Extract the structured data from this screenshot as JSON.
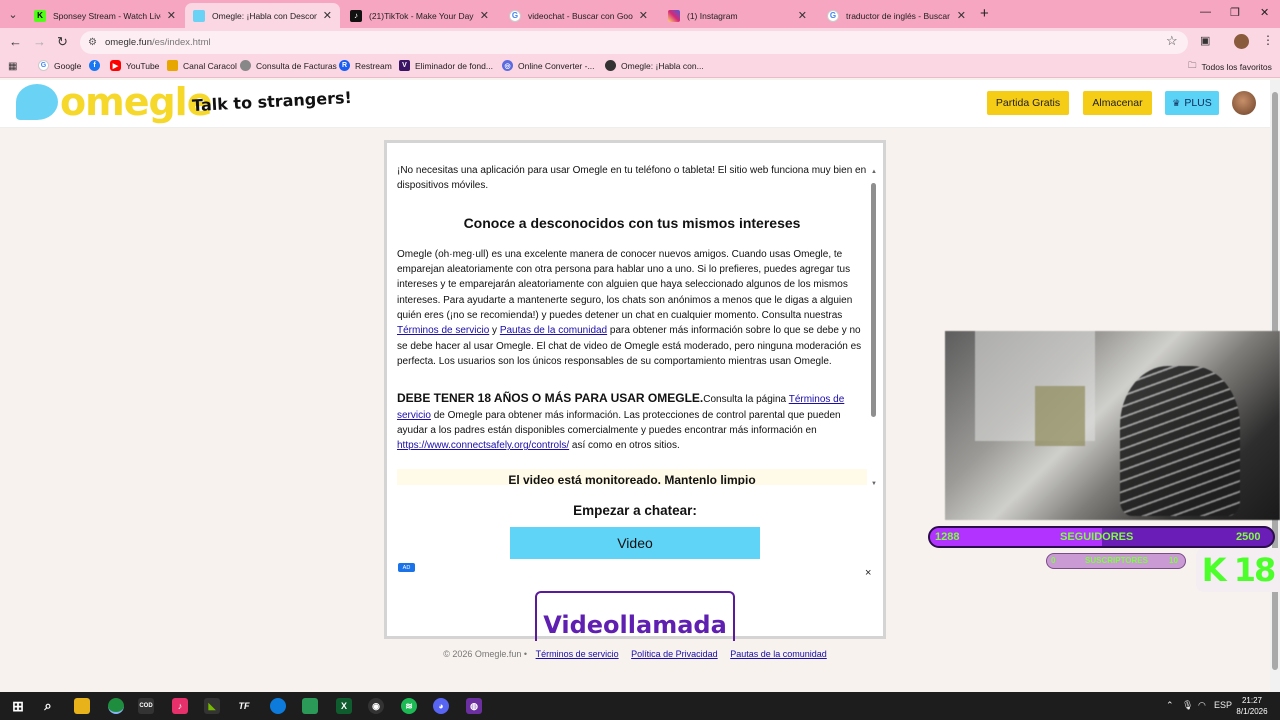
{
  "browser": {
    "tabs": [
      {
        "title": "Sponsey Stream - Watch Live o",
        "icon": "kick-icon",
        "color": "#53fc18",
        "active": false
      },
      {
        "title": "Omegle: ¡Habla con Desconoci",
        "icon": "omegle-icon",
        "color": "#6ad3f5",
        "active": true
      },
      {
        "title": "(21)TikTok - Make Your Day",
        "icon": "tiktok-icon",
        "color": "#111111",
        "active": false
      },
      {
        "title": "videochat - Buscar con Google",
        "icon": "google-icon",
        "color": "#4285f4",
        "active": false
      },
      {
        "title": "(1) Instagram",
        "icon": "instagram-icon",
        "color": "#d6249f",
        "active": false
      },
      {
        "title": "traductor de inglés - Buscar co",
        "icon": "google-icon",
        "color": "#4285f4",
        "active": false
      }
    ],
    "url_host": "omegle.fun",
    "url_path": "/es/index.html",
    "bookmarks": [
      {
        "label": "Google",
        "icon": "google-icon",
        "color": "#4285f4"
      },
      {
        "label": "",
        "icon": "facebook-icon",
        "color": "#1877f2"
      },
      {
        "label": "YouTube",
        "icon": "youtube-icon",
        "color": "#ff0000"
      },
      {
        "label": "Canal Caracol",
        "icon": "caracol-icon",
        "color": "#e8a600"
      },
      {
        "label": "Consulta de Facturas",
        "icon": "dian-icon",
        "color": "#888888"
      },
      {
        "label": "Restream",
        "icon": "restream-icon",
        "color": "#1a5ef3"
      },
      {
        "label": "Eliminador de fond...",
        "icon": "removebg-icon",
        "color": "#3b1466"
      },
      {
        "label": "Online Converter -...",
        "icon": "converter-icon",
        "color": "#5a6be0"
      },
      {
        "label": "Omegle: ¡Habla con...",
        "icon": "omegle-icon",
        "color": "#333333"
      }
    ],
    "all_bookmarks": "Todos los favoritos"
  },
  "header": {
    "logo": "omegle",
    "tagline": "Talk to strangers!",
    "buttons": {
      "free": "Partida Gratis",
      "store": "Almacenar",
      "plus": "PLUS"
    }
  },
  "content": {
    "intro": "¡No necesitas una aplicación para usar Omegle en tu teléfono o tableta! El sitio web funciona muy bien en dispositivos móviles.",
    "section_title": "Conoce a desconocidos con tus mismos intereses",
    "body_1": "Omegle (oh·meg·ull) es una excelente manera de conocer nuevos amigos. Cuando usas Omegle, te emparejan aleatoriamente con otra persona para hablar uno a uno. Si lo prefieres, puedes agregar tus intereses y te emparejarán aleatoriamente con alguien que haya seleccionado algunos de los mismos intereses. Para ayudarte a mantenerte seguro, los chats son anónimos a menos que le digas a alguien quién eres (¡no se recomienda!) y puedes detener un chat en cualquier momento. Consulta nuestras",
    "link_terms": "Términos de servicio",
    "and": "y",
    "link_guidelines": "Pautas de la comunidad",
    "body_2": "para obtener más información sobre lo que se debe y no se debe hacer al usar Omegle. El chat de video de Omegle está moderado, pero ninguna moderación es perfecta. Los usuarios son los únicos responsables de su comportamiento mientras usan Omegle.",
    "age_warning": "DEBE TENER 18 AÑOS O MÁS PARA USAR OMEGLE.",
    "age_body_1": "Consulta la página",
    "age_link": "Términos de servicio",
    "age_body_2": "de Omegle para obtener más información. Las protecciones de control parental que pueden ayudar a los padres están disponibles comercialmente y puedes encontrar más información en",
    "age_url": "https://www.connectsafely.org/controls/",
    "age_body_3": "así como en otros sitios.",
    "moderated_strip": "El video está monitoreado. Mantenlo limpio"
  },
  "start": {
    "label": "Empezar a chatear:",
    "video_button": "Video"
  },
  "ad": {
    "badge": "AD",
    "close": "×",
    "text": "Videollamada"
  },
  "footer": {
    "copyright": "© 2026 Omegle.fun •",
    "links": [
      "Términos de servicio",
      "Política de Privacidad",
      "Pautas de la comunidad"
    ]
  },
  "overlay": {
    "followers_current": "1288",
    "followers_label": "SEGUIDORES",
    "followers_goal": "2500",
    "followers_progress": 0.5,
    "subs_current": "0",
    "subs_label": "SUSCRIPTORES",
    "subs_goal": "10",
    "badge": "K 18"
  },
  "taskbar": {
    "lang": "ESP",
    "time": "21:27",
    "date": "8/1/2026"
  }
}
